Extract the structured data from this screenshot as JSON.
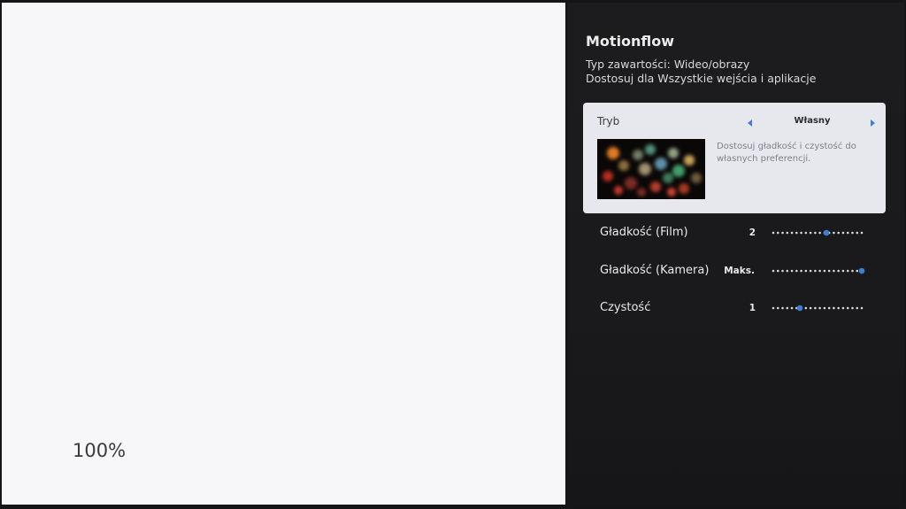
{
  "preview": {
    "percent": "100%"
  },
  "panel": {
    "title": "Motionflow",
    "content_type": "Typ zawartości: Wideo/obrazy",
    "apply_to": "Dostosuj dla Wszystkie wejścia i aplikacje"
  },
  "mode_card": {
    "label": "Tryb",
    "value": "Własny",
    "description": "Dostosuj gładkość i czystość do własnych preferencji.",
    "accent_color": "#3f7ed6"
  },
  "settings": [
    {
      "label": "Gładkość (Film)",
      "value": "2",
      "level": 0.6
    },
    {
      "label": "Gładkość (Kamera)",
      "value": "Maks.",
      "level": 1.0
    },
    {
      "label": "Czystość",
      "value": "1",
      "level": 0.3
    }
  ]
}
